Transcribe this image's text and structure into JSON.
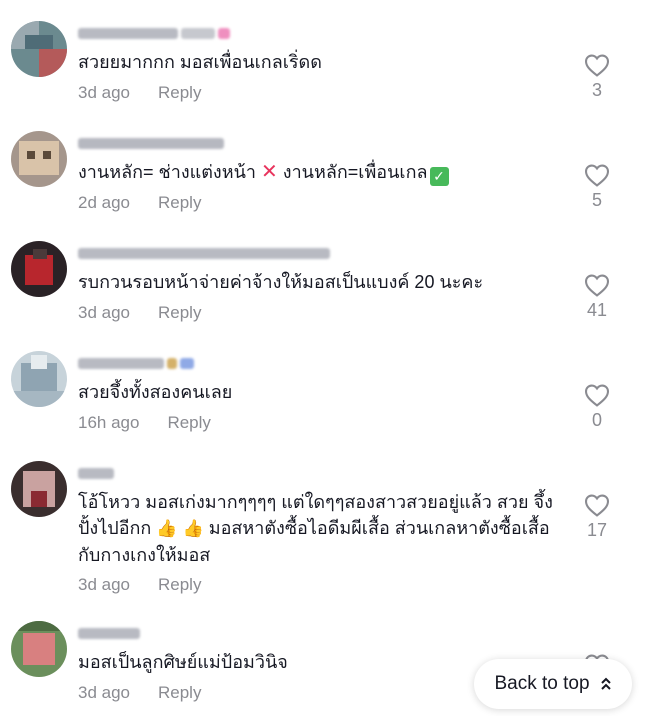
{
  "comments": [
    {
      "text": "สวยยมากกก มอสเพื่อนเกลเริ่ดด",
      "time": "3d ago",
      "reply": "Reply",
      "likes": "3"
    },
    {
      "text_a": "งานหลัก= ช่างแต่งหน้า",
      "text_b": "งานหลัก=เพื่อนเกล",
      "time": "2d ago",
      "reply": "Reply",
      "likes": "5"
    },
    {
      "text": "รบกวนรอบหน้าจ่ายค่าจ้างให้มอสเป็นแบงค์ 20 นะคะ",
      "time": "3d ago",
      "reply": "Reply",
      "likes": "41"
    },
    {
      "text": "สวยจึ้งทั้งสองคนเลย",
      "time": "16h ago",
      "reply": "Reply",
      "likes": "0"
    },
    {
      "text_a": "โอ้โหวว มอสเก่งมากๆๆๆๆ แต่ใดๆๆสองสาวสวยอยู่แล้ว สวย จึ้งปั้งไปอีกก",
      "text_b": "มอสหาตังซื้อไอดีมผีเสื้อ ส่วนเกลหาตังซื้อเสื้อกับกางเกงให้มอส",
      "time": "3d ago",
      "reply": "Reply",
      "likes": "17"
    },
    {
      "text": "มอสเป็นลูกศิษย์แม่ป้อมวินิจ",
      "time": "3d ago",
      "reply": "Reply",
      "likes": ""
    }
  ],
  "icons": {
    "like": "heart-outline-icon",
    "back_top": "double-chevron-up-icon",
    "x_emoji": "cross-mark-emoji",
    "check_emoji": "check-mark-button-emoji",
    "thumb_emoji": "thumbs-up-emoji"
  },
  "back_to_top": "Back to top",
  "colors": {
    "text": "#161823",
    "meta": "#8a8b91",
    "x_emoji": "#e8345d",
    "check_emoji": "#47b95a"
  }
}
